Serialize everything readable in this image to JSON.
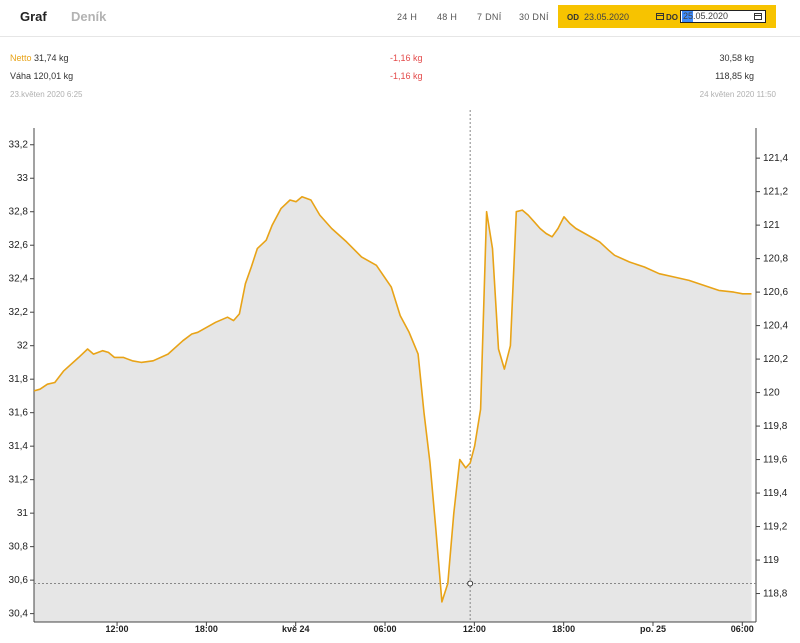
{
  "tabs": {
    "graf": "Graf",
    "denik": "Deník"
  },
  "ranges": [
    "24 H",
    "48 H",
    "7 DNÍ",
    "30 DNÍ"
  ],
  "date_filter": {
    "od_label": "OD",
    "od_value": "23.05.2020",
    "do_label": "DO",
    "do_value": "25.05.2020",
    "accent": "#f7c300"
  },
  "stats": {
    "netto_label": "Netto",
    "netto_value": "31,74 kg",
    "netto_change": "-1,16 kg",
    "netto_end": "30,58 kg",
    "vaha_label": "Váha",
    "vaha_value": "120,01 kg",
    "vaha_change": "-1,16 kg",
    "vaha_end": "118,85 kg",
    "start_time": "23.květen 2020 6:25",
    "end_time": "24 květen 2020 11:50"
  },
  "chart_data": {
    "type": "area",
    "title": "",
    "xlabel": "",
    "ylabel": "",
    "line_color": "#e8a317",
    "fill_color": "#e6e6e6",
    "x_unit": "hours since 23.05.2020 06:25",
    "x_range": [
      0,
      48.5
    ],
    "xtick_labels": [
      {
        "label": "12:00",
        "x": 5.58
      },
      {
        "label": "18:00",
        "x": 11.58
      },
      {
        "label": "kvě 24",
        "x": 17.58
      },
      {
        "label": "06:00",
        "x": 23.58
      },
      {
        "label": "12:00",
        "x": 29.58
      },
      {
        "label": "18:00",
        "x": 35.58
      },
      {
        "label": "po. 25",
        "x": 41.58
      },
      {
        "label": "06:00",
        "x": 47.58
      }
    ],
    "ylim_left": [
      30.35,
      33.3
    ],
    "yticks_left": [
      "30,4",
      "30,6",
      "30,8",
      "31",
      "31,2",
      "31,4",
      "31,6",
      "31,8",
      "32",
      "32,2",
      "32,4",
      "32,6",
      "32,8",
      "33",
      "33,2"
    ],
    "ylim_right": [
      118.63,
      121.58
    ],
    "yticks_right": [
      "118,8",
      "119",
      "119,2",
      "119,4",
      "119,6",
      "119,8",
      "120",
      "120,2",
      "120,4",
      "120,6",
      "120,8",
      "121",
      "121,2",
      "121,4"
    ],
    "cursor": {
      "x": 29.3,
      "y": 30.58
    },
    "series": [
      {
        "name": "Netto",
        "x": [
          0,
          0.4,
          0.9,
          1.4,
          2.0,
          3.0,
          3.6,
          4.0,
          4.6,
          5.0,
          5.4,
          6.0,
          6.6,
          7.2,
          8.0,
          9.0,
          10.0,
          10.6,
          11.0,
          11.6,
          12.2,
          13.0,
          13.4,
          13.8,
          14.2,
          14.6,
          15.0,
          15.6,
          16.0,
          16.6,
          17.2,
          17.6,
          18.0,
          18.6,
          19.2,
          20.0,
          21.0,
          22.0,
          23.0,
          24.0,
          24.6,
          25.2,
          25.8,
          26.2,
          26.6,
          27.0,
          27.4,
          27.8,
          28.2,
          28.6,
          29.0,
          29.3,
          29.6,
          30.0,
          30.4,
          30.8,
          31.2,
          31.6,
          32.0,
          32.4,
          32.8,
          33.2,
          33.6,
          34.0,
          34.4,
          34.8,
          35.2,
          35.6,
          36.0,
          36.4,
          37.0,
          37.6,
          38.0,
          38.6,
          39.0,
          40.0,
          41.0,
          42.0,
          43.0,
          44.0,
          45.0,
          46.0,
          47.0,
          47.6,
          48.2
        ],
        "y": [
          31.73,
          31.74,
          31.77,
          31.78,
          31.85,
          31.93,
          31.98,
          31.95,
          31.97,
          31.96,
          31.93,
          31.93,
          31.91,
          31.9,
          31.91,
          31.95,
          32.03,
          32.07,
          32.08,
          32.11,
          32.14,
          32.17,
          32.15,
          32.19,
          32.37,
          32.47,
          32.58,
          32.63,
          32.72,
          32.82,
          32.87,
          32.86,
          32.89,
          32.87,
          32.78,
          32.7,
          32.62,
          32.53,
          32.48,
          32.35,
          32.18,
          32.08,
          31.95,
          31.6,
          31.3,
          30.9,
          30.47,
          30.58,
          31.0,
          31.32,
          31.27,
          31.3,
          31.4,
          31.62,
          32.8,
          32.58,
          31.98,
          31.86,
          32.0,
          32.8,
          32.81,
          32.78,
          32.74,
          32.7,
          32.67,
          32.65,
          32.7,
          32.77,
          32.73,
          32.7,
          32.67,
          32.64,
          32.62,
          32.57,
          32.54,
          32.5,
          32.47,
          32.43,
          32.41,
          32.39,
          32.36,
          32.33,
          32.32,
          32.31,
          32.31
        ]
      }
    ]
  }
}
